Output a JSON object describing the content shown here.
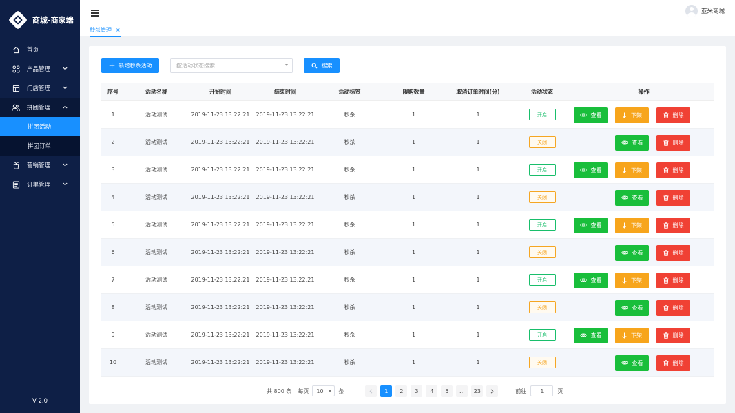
{
  "brand": {
    "title": "商城-商家端"
  },
  "sidebar": {
    "items": [
      {
        "label": "首页",
        "icon": "home-icon"
      },
      {
        "label": "产品管理",
        "icon": "grid-icon",
        "chevron": "down"
      },
      {
        "label": "门店管理",
        "icon": "store-icon",
        "chevron": "down"
      },
      {
        "label": "拼团管理",
        "icon": "users-icon",
        "chevron": "up",
        "expanded": true
      }
    ],
    "submenu": [
      {
        "label": "拼团活动",
        "active": true
      },
      {
        "label": "拼团订单",
        "active": false
      }
    ],
    "items_after": [
      {
        "label": "营销管理",
        "icon": "gift-icon",
        "chevron": "down"
      },
      {
        "label": "订单管理",
        "icon": "list-icon",
        "chevron": "down"
      }
    ],
    "version": "V 2.0"
  },
  "header": {
    "user_name": "亚米商城"
  },
  "tabs": [
    {
      "label": "秒杀管理",
      "close": "×"
    }
  ],
  "toolbar": {
    "add_label": "新增秒杀活动",
    "search_placeholder": "按活动状态搜索",
    "search_label": "搜索"
  },
  "table": {
    "columns": [
      "序号",
      "活动名称",
      "开始时间",
      "结束时间",
      "活动标签",
      "限购数量",
      "取消订单时间(分)",
      "活动状态",
      "操作"
    ],
    "rows": [
      {
        "no": "1",
        "name": "活动测试",
        "start": "2019-11-23 13:22:21",
        "end": "2019-11-23 13:22:21",
        "tag": "秒杀",
        "limit": "1",
        "cancel": "1",
        "status": "开启",
        "on": true
      },
      {
        "no": "2",
        "name": "活动测试",
        "start": "2019-11-23 13:22:21",
        "end": "2019-11-23 13:22:21",
        "tag": "秒杀",
        "limit": "1",
        "cancel": "1",
        "status": "关闭",
        "on": false
      },
      {
        "no": "3",
        "name": "活动测试",
        "start": "2019-11-23 13:22:21",
        "end": "2019-11-23 13:22:21",
        "tag": "秒杀",
        "limit": "1",
        "cancel": "1",
        "status": "开启",
        "on": true
      },
      {
        "no": "4",
        "name": "活动测试",
        "start": "2019-11-23 13:22:21",
        "end": "2019-11-23 13:22:21",
        "tag": "秒杀",
        "limit": "1",
        "cancel": "1",
        "status": "关闭",
        "on": false
      },
      {
        "no": "5",
        "name": "活动测试",
        "start": "2019-11-23 13:22:21",
        "end": "2019-11-23 13:22:21",
        "tag": "秒杀",
        "limit": "1",
        "cancel": "1",
        "status": "开启",
        "on": true
      },
      {
        "no": "6",
        "name": "活动测试",
        "start": "2019-11-23 13:22:21",
        "end": "2019-11-23 13:22:21",
        "tag": "秒杀",
        "limit": "1",
        "cancel": "1",
        "status": "关闭",
        "on": false
      },
      {
        "no": "7",
        "name": "活动测试",
        "start": "2019-11-23 13:22:21",
        "end": "2019-11-23 13:22:21",
        "tag": "秒杀",
        "limit": "1",
        "cancel": "1",
        "status": "开启",
        "on": true
      },
      {
        "no": "8",
        "name": "活动测试",
        "start": "2019-11-23 13:22:21",
        "end": "2019-11-23 13:22:21",
        "tag": "秒杀",
        "limit": "1",
        "cancel": "1",
        "status": "关闭",
        "on": false
      },
      {
        "no": "9",
        "name": "活动测试",
        "start": "2019-11-23 13:22:21",
        "end": "2019-11-23 13:22:21",
        "tag": "秒杀",
        "limit": "1",
        "cancel": "1",
        "status": "开启",
        "on": true
      },
      {
        "no": "10",
        "name": "活动测试",
        "start": "2019-11-23 13:22:21",
        "end": "2019-11-23 13:22:21",
        "tag": "秒杀",
        "limit": "1",
        "cancel": "1",
        "status": "关闭",
        "on": false
      }
    ],
    "actions": {
      "view": "查看",
      "offline": "下架",
      "delete": "删除"
    }
  },
  "pagination": {
    "total_text": "共 800 条",
    "per_page_label": "每页",
    "per_page_value": "10",
    "per_page_unit": "条",
    "pages": [
      "1",
      "2",
      "3",
      "4",
      "5",
      "...",
      "23"
    ],
    "current": "1",
    "goto_label": "前往",
    "goto_value": "1",
    "goto_unit": "页"
  },
  "colors": {
    "sidebar_bg": "#0e1f46",
    "accent": "#1890ff",
    "success": "#19be3b",
    "warning": "#f7a51c",
    "danger": "#f04134"
  }
}
